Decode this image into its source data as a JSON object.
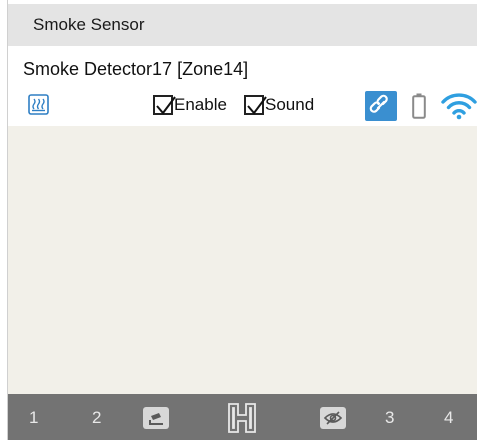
{
  "title_bar": {
    "title": "Smoke Sensor"
  },
  "device": {
    "name": "Smoke Detector17 [Zone14]",
    "enable": {
      "label": "Enable",
      "checked": true
    },
    "sound": {
      "label": "Sound",
      "checked": true
    },
    "icons": [
      "heater-icon",
      "link-icon",
      "battery-icon",
      "wifi-icon"
    ]
  },
  "nav_bar": {
    "items": [
      {
        "label": "1"
      },
      {
        "label": "2"
      },
      {
        "icon": "camera-icon"
      },
      {
        "icon": "floorplan-h-icon"
      },
      {
        "icon": "eye-hidden-icon"
      },
      {
        "label": "3"
      },
      {
        "label": "4"
      }
    ]
  },
  "colors": {
    "title_bar_bg": "#e4e4e4",
    "content_bg": "#f2f0e9",
    "nav_bar_bg": "#737373",
    "accent": "#3a8fd0"
  }
}
